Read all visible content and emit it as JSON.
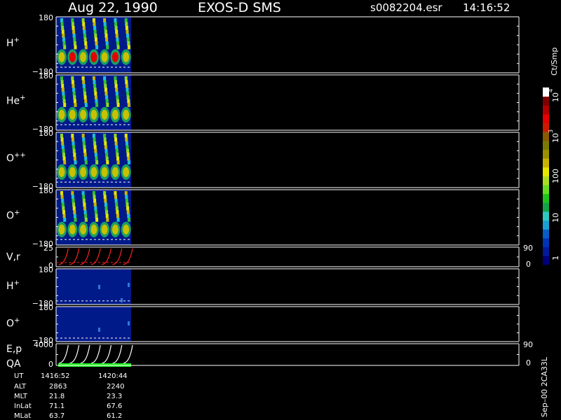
{
  "header": {
    "date": "Aug 22, 1990",
    "instrument": "EXOS-D SMS",
    "file": "s0082204.esr",
    "time": "14:16:52"
  },
  "colorbar": {
    "unit": "Ct/Smp",
    "ticks": [
      "1",
      "10",
      "100",
      "10",
      "3",
      "10",
      "4"
    ],
    "tick_values": [
      1,
      10,
      100,
      1000,
      10000
    ],
    "colors": [
      "#00007a",
      "#001a9a",
      "#0033b5",
      "#0a5cc8",
      "#1aa0d0",
      "#2ec8c0",
      "#15a34a",
      "#1fc21f",
      "#66dd22",
      "#aadd22",
      "#e6e600",
      "#c8b400",
      "#9a8f00",
      "#7a7a00",
      "#8a5a00",
      "#cc1a00",
      "#e60000",
      "#b30000",
      "#800000",
      "#ffffff"
    ]
  },
  "chart_data": {
    "type": "heatmap",
    "x_range_ut": [
      "1416:52",
      "1420:44"
    ],
    "panels": [
      {
        "label": "H",
        "sup": "+",
        "ymin": "−180",
        "ymax": "180",
        "kind": "spectrogram"
      },
      {
        "label": "He",
        "sup": "+",
        "ymin": "−180",
        "ymax": "180",
        "kind": "spectrogram"
      },
      {
        "label": "O",
        "sup": "++",
        "ymin": "−180",
        "ymax": "180",
        "kind": "spectrogram"
      },
      {
        "label": "O",
        "sup": "+",
        "ymin": "−180",
        "ymax": "180",
        "kind": "spectrogram"
      },
      {
        "label": "V,r",
        "ymin": "0",
        "ymax": "25",
        "right_top": "90",
        "right_bottom": "0",
        "kind": "line"
      },
      {
        "label": "H",
        "sup": "+",
        "ymin": "−180",
        "ymax": "180",
        "kind": "spectrogram_low"
      },
      {
        "label": "O",
        "sup": "+",
        "ymin": "−180",
        "ymax": "180",
        "kind": "spectrogram_low"
      },
      {
        "label": "E,p",
        "label2": "QA",
        "ymin": "0",
        "ymax": "4000",
        "right_top": "90",
        "right_bottom": "0",
        "kind": "line2"
      }
    ]
  },
  "orbit": {
    "rows": [
      {
        "name": "UT",
        "values": [
          "1416:52",
          "1420:44"
        ]
      },
      {
        "name": "ALT",
        "values": [
          "2863",
          "2240"
        ]
      },
      {
        "name": "MLT",
        "values": [
          "21.8",
          "23.3"
        ]
      },
      {
        "name": "InLat",
        "values": [
          "71.1",
          "67.6"
        ]
      },
      {
        "name": "MLat",
        "values": [
          "63.7",
          "61.2"
        ]
      }
    ]
  },
  "footer_stamp": "Sep–00  2CA33L"
}
